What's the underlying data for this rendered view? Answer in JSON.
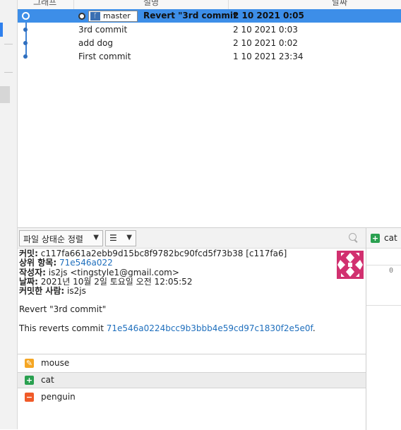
{
  "header": {
    "col_graph": "그래프",
    "col_desc": "설명",
    "col_date": "날짜"
  },
  "commits": [
    {
      "branch": "master",
      "description": "Revert \"3rd commit",
      "date": "2 10 2021 0:05"
    },
    {
      "description": "3rd commit",
      "date": "2 10 2021 0:03"
    },
    {
      "description": "add dog",
      "date": "2 10 2021 0:02"
    },
    {
      "description": "First commit",
      "date": "1 10 2021 23:34"
    }
  ],
  "toolbar": {
    "sort_label": "파일 상태순 정렬",
    "view_label": "☰"
  },
  "details": {
    "commit_label": "커밋:",
    "commit_value": "c117fa661a2ebb9d15bc8f9782bc90fcd5f73b38 [c117fa6]",
    "parent_label": "상위 항목:",
    "parent_value": "71e546a022",
    "author_label": "작성자:",
    "author_value": "is2js <tingstyle1@gmail.com>",
    "date_label": "날짜:",
    "date_value": "2021년 10월 2일 토요일 오전 12:05:52",
    "committer_label": "커밋한 사람:",
    "committer_value": "is2js",
    "message": "Revert \"3rd commit\"",
    "body_prefix": "This reverts commit ",
    "body_hash": "71e546a0224bcc9b3bbb4e59cd97c1830f2e5e0f",
    "body_suffix": "."
  },
  "files": [
    {
      "name": "mouse",
      "status": "modified",
      "color": "#f5a623"
    },
    {
      "name": "cat",
      "status": "added",
      "color": "#2aa050"
    },
    {
      "name": "penguin",
      "status": "removed",
      "color": "#f05a28"
    }
  ],
  "diff": {
    "title": "cat",
    "line_number": "0"
  },
  "colors": {
    "accent": "#3d8ee8",
    "link": "#1f6fbd",
    "avatar": "#d1306f"
  }
}
